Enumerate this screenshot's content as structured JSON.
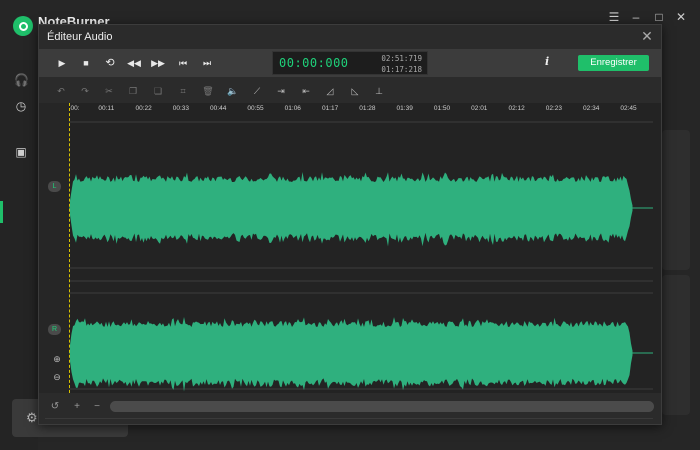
{
  "app": {
    "name": "NoteBurner"
  },
  "window_controls": [
    "menu-icon",
    "minimize-icon",
    "maximize-icon",
    "close-icon"
  ],
  "editor": {
    "title": "Éditeur Audio",
    "time_current": "00:00:000",
    "time_total": "02:51:719",
    "time_selection": "01:17:218",
    "info_label": "i",
    "save_label": "Enregistrer",
    "transport_icons": [
      "play-icon",
      "stop-icon",
      "loop-icon",
      "rewind-icon",
      "fast-forward-icon",
      "skip-start-icon",
      "skip-end-icon"
    ],
    "edit_icons": [
      "undo-icon",
      "redo-icon",
      "cut-icon",
      "copy-icon",
      "paste-icon",
      "crop-icon",
      "delete-icon",
      "volume-icon",
      "amplify-icon",
      "trim-silence-icon",
      "insert-silence-icon",
      "fade-in-icon",
      "fade-out-icon",
      "noise-icon"
    ],
    "channels": {
      "left": "L",
      "right": "R"
    },
    "ruler_ticks": [
      "00:",
      "00:11",
      "00:22",
      "00:33",
      "00:44",
      "00:55",
      "01:06",
      "01:17",
      "01:28",
      "01:39",
      "01:50",
      "02:01",
      "02:12",
      "02:23",
      "02:34",
      "02:45"
    ]
  },
  "colors": {
    "accent": "#1fbf6a",
    "waveform": "#2fb07e",
    "time_display": "#1fd17a",
    "playhead": "#d8c200"
  }
}
